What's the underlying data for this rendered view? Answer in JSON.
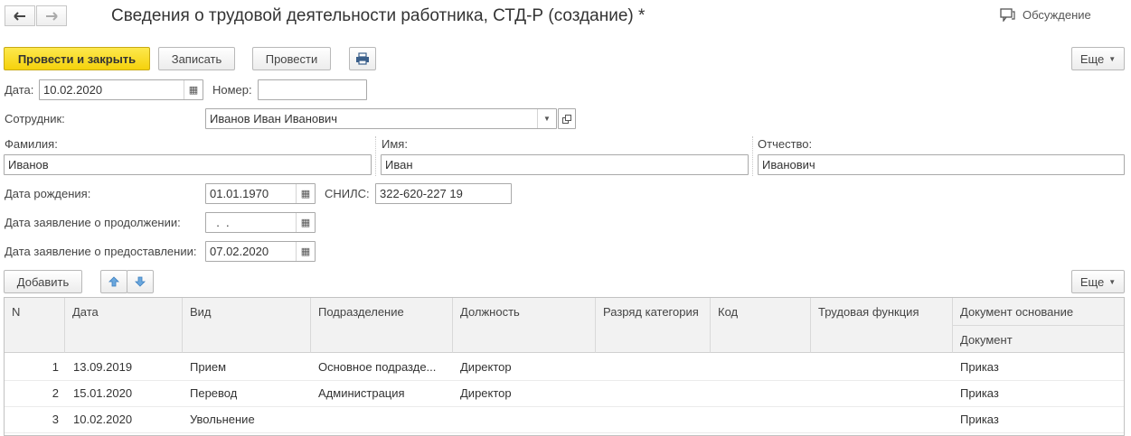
{
  "window": {
    "title": "Сведения о трудовой деятельности работника, СТД-Р (создание) *",
    "discussion_label": "Обсуждение"
  },
  "toolbar": {
    "post_close": "Провести и закрыть",
    "save": "Записать",
    "post": "Провести",
    "more": "Еще"
  },
  "form": {
    "date_label": "Дата:",
    "date_value": "10.02.2020",
    "number_label": "Номер:",
    "number_value": "",
    "employee_label": "Сотрудник:",
    "employee_value": "Иванов Иван Иванович",
    "lastname_label": "Фамилия:",
    "lastname_value": "Иванов",
    "firstname_label": "Имя:",
    "firstname_value": "Иван",
    "middlename_label": "Отчество:",
    "middlename_value": "Иванович",
    "birthdate_label": "Дата рождения:",
    "birthdate_value": "01.01.1970",
    "snils_label": "СНИЛС:",
    "snils_value": "322-620-227 19",
    "continue_label": "Дата заявление о продолжении:",
    "continue_value": "  .  .",
    "provide_label": "Дата заявление о предоставлении:",
    "provide_value": "07.02.2020"
  },
  "table_toolbar": {
    "add": "Добавить",
    "more": "Еще"
  },
  "table": {
    "headers": [
      "N",
      "Дата",
      "Вид",
      "Подразделение",
      "Должность",
      "Разряд категория",
      "Код",
      "Трудовая функция",
      "Документ основание",
      "Документ"
    ],
    "rows": [
      {
        "n": "1",
        "date": "13.09.2019",
        "kind": "Прием",
        "dept": "Основное подразде...",
        "position": "Директор",
        "grade": "",
        "code": "",
        "func": "",
        "doc": "Приказ"
      },
      {
        "n": "2",
        "date": "15.01.2020",
        "kind": "Перевод",
        "dept": "Администрация",
        "position": "Директор",
        "grade": "",
        "code": "",
        "func": "",
        "doc": "Приказ"
      },
      {
        "n": "3",
        "date": "10.02.2020",
        "kind": "Увольнение",
        "dept": "",
        "position": "",
        "grade": "",
        "code": "",
        "func": "",
        "doc": "Приказ"
      }
    ]
  }
}
